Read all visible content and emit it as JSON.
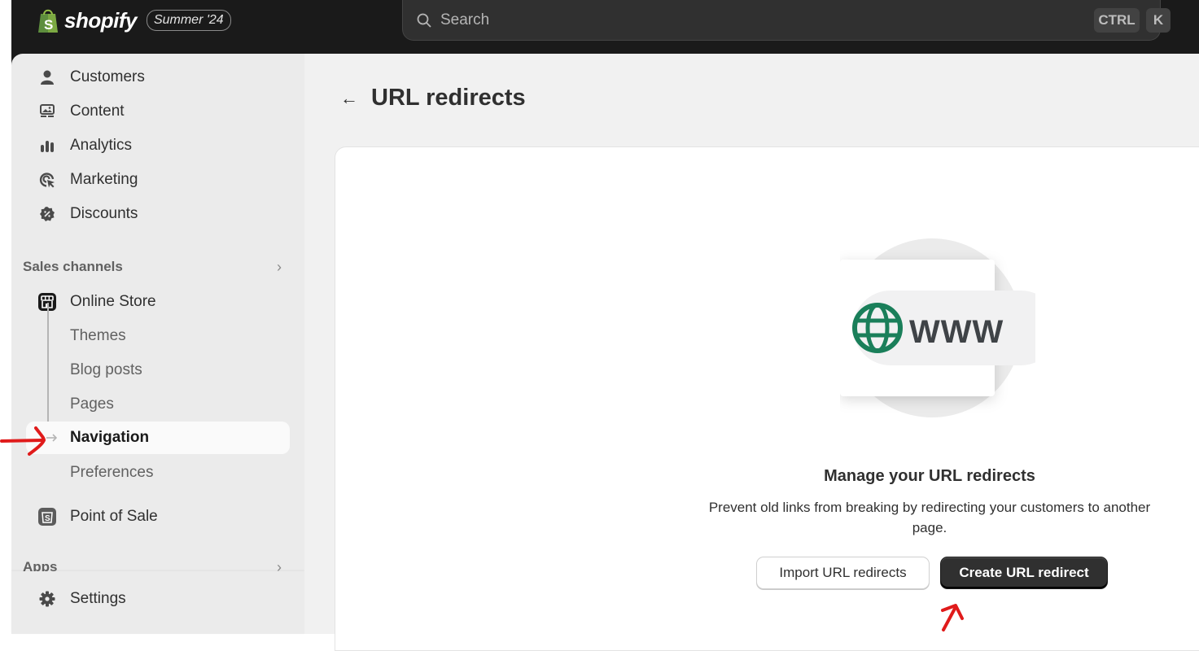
{
  "topbar": {
    "brand": "shopify",
    "edition_badge": "Summer '24",
    "search": {
      "placeholder": "Search",
      "shortcut_keys": [
        "CTRL",
        "K"
      ]
    }
  },
  "sidebar": {
    "items": [
      {
        "label": "Customers",
        "icon": "person-icon"
      },
      {
        "label": "Content",
        "icon": "content-icon"
      },
      {
        "label": "Analytics",
        "icon": "bar-chart-icon"
      },
      {
        "label": "Marketing",
        "icon": "target-icon"
      },
      {
        "label": "Discounts",
        "icon": "discount-icon"
      }
    ],
    "sales_channels": {
      "label": "Sales channels",
      "online_store": {
        "label": "Online Store",
        "subitems": [
          {
            "label": "Themes",
            "active": false
          },
          {
            "label": "Blog posts",
            "active": false
          },
          {
            "label": "Pages",
            "active": false
          },
          {
            "label": "Navigation",
            "active": true
          },
          {
            "label": "Preferences",
            "active": false
          }
        ]
      },
      "point_of_sale": {
        "label": "Point of Sale"
      }
    },
    "apps": {
      "label": "Apps"
    },
    "settings": {
      "label": "Settings"
    }
  },
  "main": {
    "page_title": "URL redirects",
    "illustration_text": "WWW",
    "empty_state": {
      "title": "Manage your URL redirects",
      "description": "Prevent old links from breaking by redirecting your customers to another page.",
      "secondary_action": "Import URL redirects",
      "primary_action": "Create URL redirect"
    }
  },
  "colors": {
    "topbar_bg": "#1a1a1a",
    "sidebar_bg": "#ebebeb",
    "main_bg": "#f1f1f1",
    "brand_green": "#008060",
    "globe_green": "#1a7f5a",
    "primary_button": "#303030",
    "annotation_red": "#e01b1b"
  }
}
